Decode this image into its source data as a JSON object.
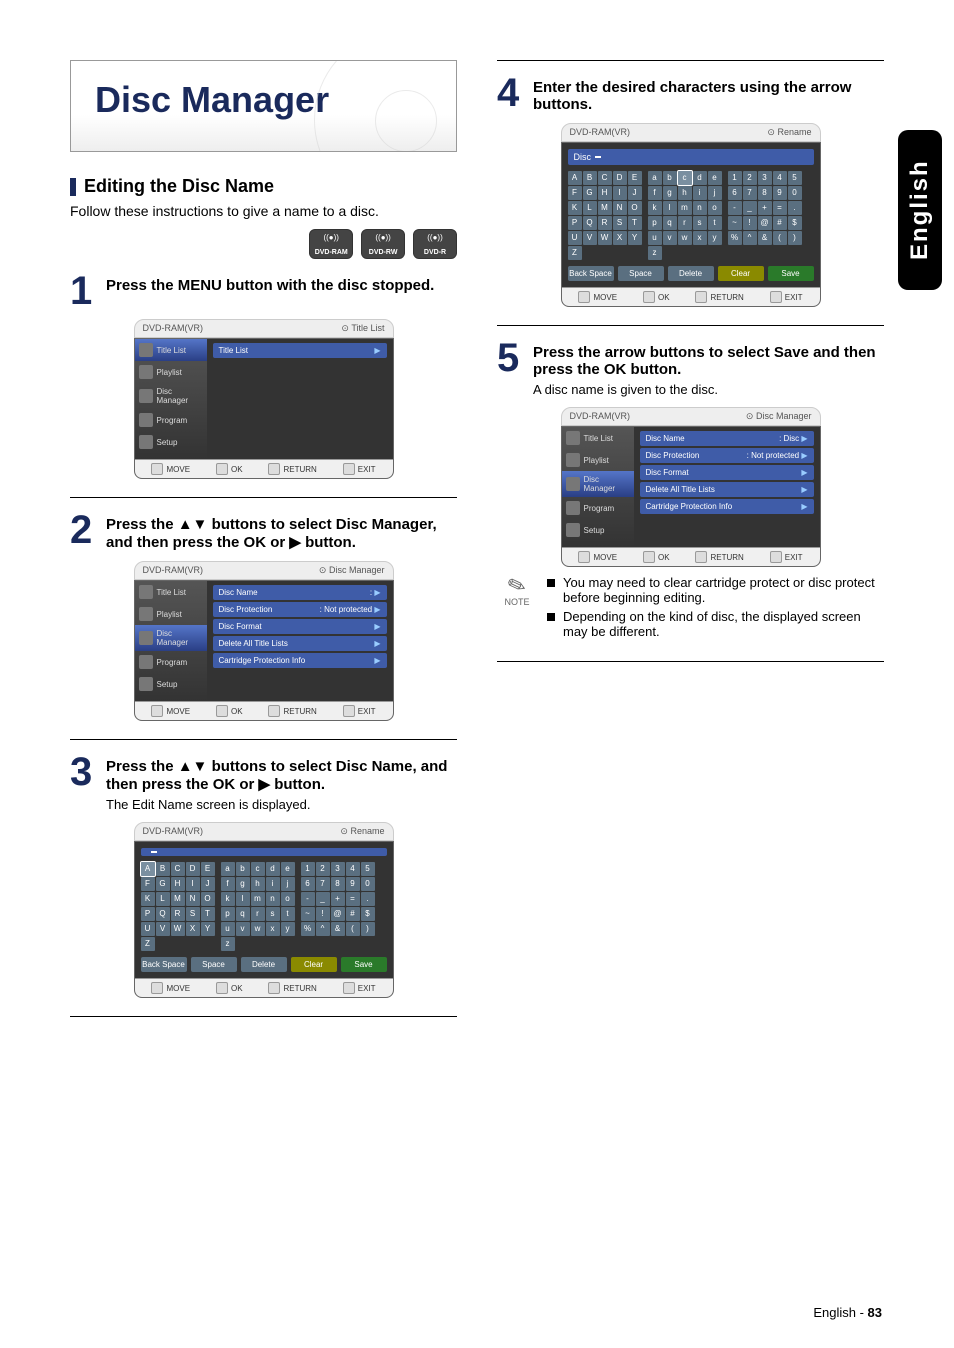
{
  "language_tab": "English",
  "footer": {
    "lang": "English",
    "sep": " - ",
    "page": "83"
  },
  "title": "Disc Manager",
  "section": {
    "heading": "Editing the Disc Name",
    "intro": "Follow these instructions to give a name to a disc."
  },
  "disc_badges": [
    "DVD-RAM",
    "DVD-RW",
    "DVD-R"
  ],
  "steps": {
    "s1": {
      "num": "1",
      "text": "Press the MENU button with the disc stopped."
    },
    "s2": {
      "num": "2",
      "text": "Press the ▲▼ buttons to select Disc Manager, and then press the OK or ▶ button."
    },
    "s3": {
      "num": "3",
      "text": "Press the ▲▼ buttons to select Disc Name, and then press the OK or ▶ button.",
      "sub": "The Edit Name screen is displayed."
    },
    "s4": {
      "num": "4",
      "text": "Enter the desired characters using the arrow buttons."
    },
    "s5": {
      "num": "5",
      "text": "Press the arrow buttons to select Save and then press the OK button.",
      "sub": "A disc name is given to the disc."
    }
  },
  "notes": {
    "label": "NOTE",
    "n1": "You may need to clear cartridge protect or disc protect before beginning editing.",
    "n2": "Depending on the kind of disc, the displayed screen may be different."
  },
  "osd_common": {
    "device": "DVD-RAM(VR)",
    "footer": {
      "move": "MOVE",
      "ok": "OK",
      "return": "RETURN",
      "exit": "EXIT"
    }
  },
  "osd1": {
    "header_right": "Title List",
    "sidebar": [
      "Title List",
      "Playlist",
      "Disc Manager",
      "Program",
      "Setup"
    ],
    "main_row": "Title List"
  },
  "osd2": {
    "header_right": "Disc Manager",
    "sidebar": [
      "Title List",
      "Playlist",
      "Disc Manager",
      "Program",
      "Setup"
    ],
    "rows": [
      {
        "l": "Disc Name",
        "r": ":"
      },
      {
        "l": "Disc Protection",
        "r": ": Not protected"
      },
      {
        "l": "Disc Format",
        "r": ""
      },
      {
        "l": "Delete All Title Lists",
        "r": ""
      },
      {
        "l": "Cartridge Protection Info",
        "r": ""
      }
    ]
  },
  "osd3": {
    "header_right": "Rename",
    "field_label": "",
    "sel_key": "A",
    "bottom_buttons": [
      "Back Space",
      "Space",
      "Delete",
      "Clear",
      "Save"
    ]
  },
  "osd4": {
    "header_right": "Rename",
    "field_label": "Disc",
    "sel_key": "c",
    "bottom_buttons": [
      "Back Space",
      "Space",
      "Delete",
      "Clear",
      "Save"
    ]
  },
  "osd5": {
    "header_right": "Disc Manager",
    "sidebar": [
      "Title List",
      "Playlist",
      "Disc Manager",
      "Program",
      "Setup"
    ],
    "rows": [
      {
        "l": "Disc Name",
        "r": ": Disc"
      },
      {
        "l": "Disc Protection",
        "r": ": Not protected"
      },
      {
        "l": "Disc Format",
        "r": ""
      },
      {
        "l": "Delete All Title Lists",
        "r": ""
      },
      {
        "l": "Cartridge Protection Info",
        "r": ""
      }
    ]
  },
  "kb": {
    "upper": [
      "A",
      "B",
      "C",
      "D",
      "E",
      "F",
      "G",
      "H",
      "I",
      "J",
      "K",
      "L",
      "M",
      "N",
      "O",
      "P",
      "Q",
      "R",
      "S",
      "T",
      "U",
      "V",
      "W",
      "X",
      "Y",
      "Z"
    ],
    "lower": [
      "a",
      "b",
      "c",
      "d",
      "e",
      "f",
      "g",
      "h",
      "i",
      "j",
      "k",
      "l",
      "m",
      "n",
      "o",
      "p",
      "q",
      "r",
      "s",
      "t",
      "u",
      "v",
      "w",
      "x",
      "y",
      "z"
    ],
    "sym": [
      "1",
      "2",
      "3",
      "4",
      "5",
      "6",
      "7",
      "8",
      "9",
      "0",
      "-",
      "_",
      "+",
      "=",
      ".",
      "~",
      "!",
      "@",
      "#",
      "$",
      "%",
      "^",
      "&",
      "(",
      ")"
    ]
  }
}
